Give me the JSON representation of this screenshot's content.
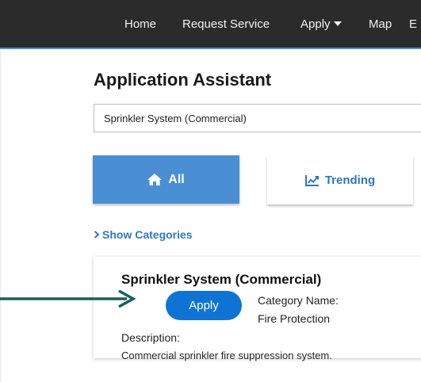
{
  "nav": {
    "items": [
      "Home",
      "Request Service",
      "Apply",
      "Map"
    ],
    "more_partial": "E"
  },
  "page": {
    "title": "Application Assistant"
  },
  "search": {
    "value": "Sprinkler System (Commercial)"
  },
  "tabs": {
    "all": "All",
    "trending": "Trending"
  },
  "categories_toggle": "Show Categories",
  "result": {
    "title": "Sprinkler System (Commercial)",
    "apply_label": "Apply",
    "category_label": "Category Name:",
    "category_value": "Fire Protection",
    "description_label": "Description:",
    "description_value": "Commercial sprinkler fire suppression system."
  },
  "colors": {
    "nav_bg": "#2b2b2b",
    "accent_blue": "#4a8fd4",
    "apply_blue": "#0f73d6",
    "link_blue": "#2f76c3",
    "annotation_arrow": "#1b5e5b"
  }
}
